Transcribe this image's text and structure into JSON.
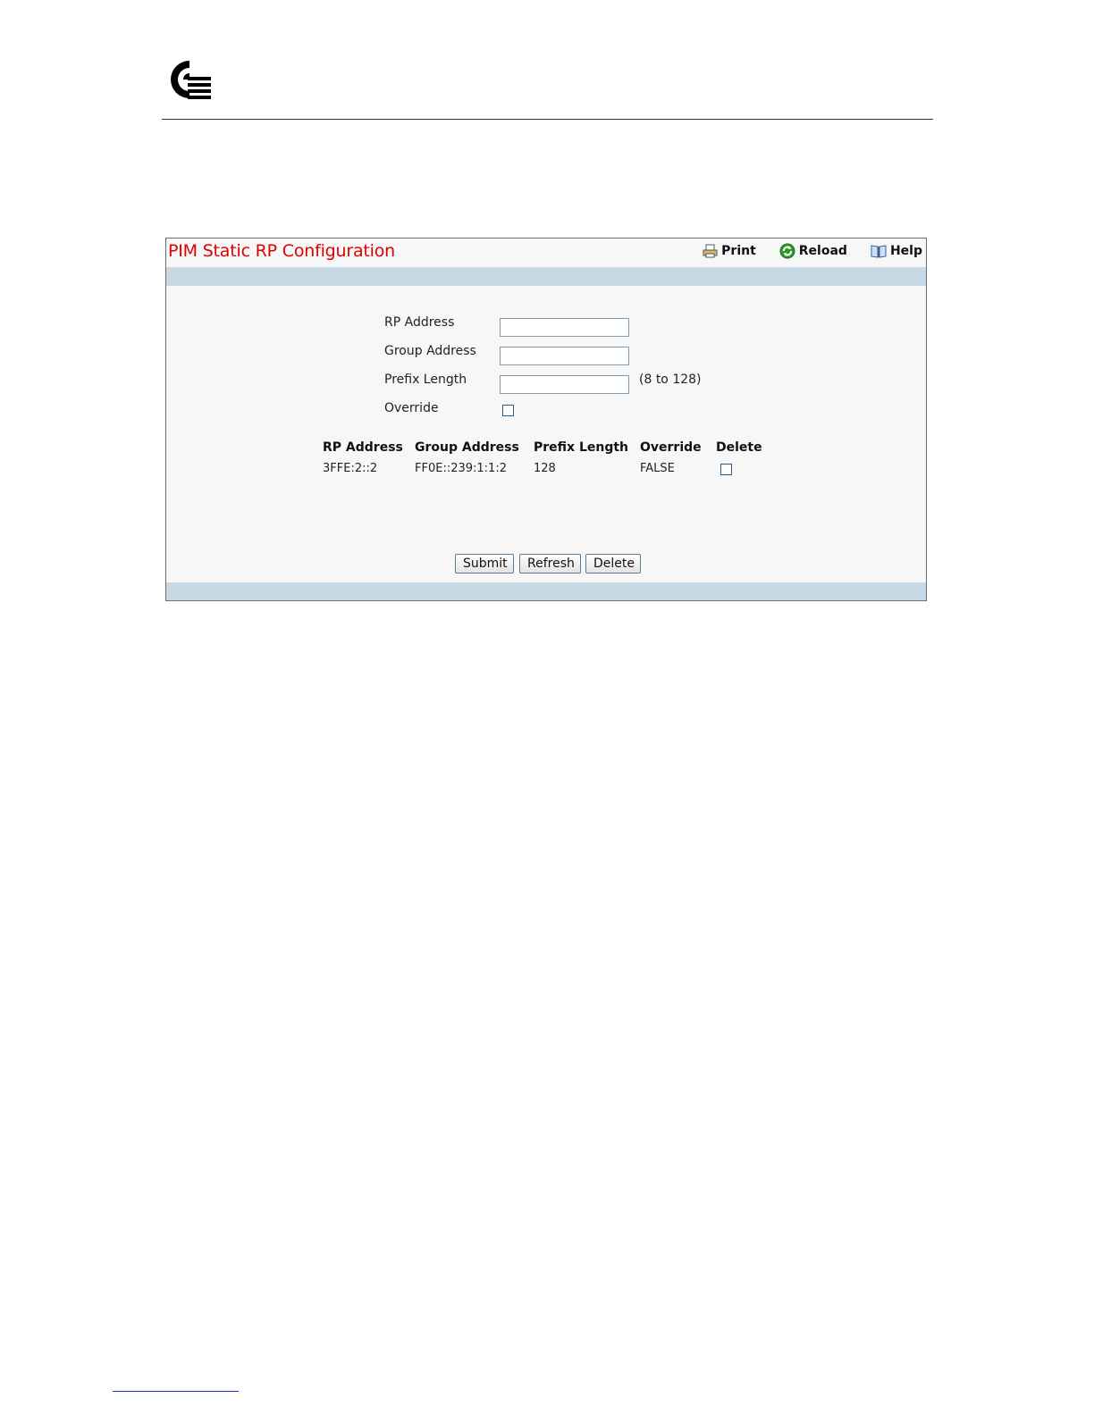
{
  "panel": {
    "title": "PIM Static RP Configuration",
    "toolbar": {
      "print": "Print",
      "reload": "Reload",
      "help": "Help"
    }
  },
  "form": {
    "rp_address": {
      "label": "RP Address",
      "value": ""
    },
    "group_address": {
      "label": "Group Address",
      "value": ""
    },
    "prefix_length": {
      "label": "Prefix Length",
      "value": "",
      "hint": "(8 to 128)"
    },
    "override": {
      "label": "Override",
      "checked": false
    }
  },
  "table": {
    "columns": [
      "RP Address",
      "Group Address",
      "Prefix Length",
      "Override",
      "Delete"
    ],
    "rows": [
      {
        "rp_address": "3FFE:2::2",
        "group_address": "FF0E::239:1:1:2",
        "prefix_length": "128",
        "override": "FALSE",
        "delete": false
      }
    ]
  },
  "buttons": {
    "submit": "Submit",
    "refresh": "Refresh",
    "delete": "Delete"
  },
  "colors": {
    "title": "#e00000",
    "band": "#c7d9e5",
    "panel_bg": "#f7f7f7"
  },
  "icons": [
    "logo-icon",
    "printer-icon",
    "reload-icon",
    "help-book-icon"
  ]
}
